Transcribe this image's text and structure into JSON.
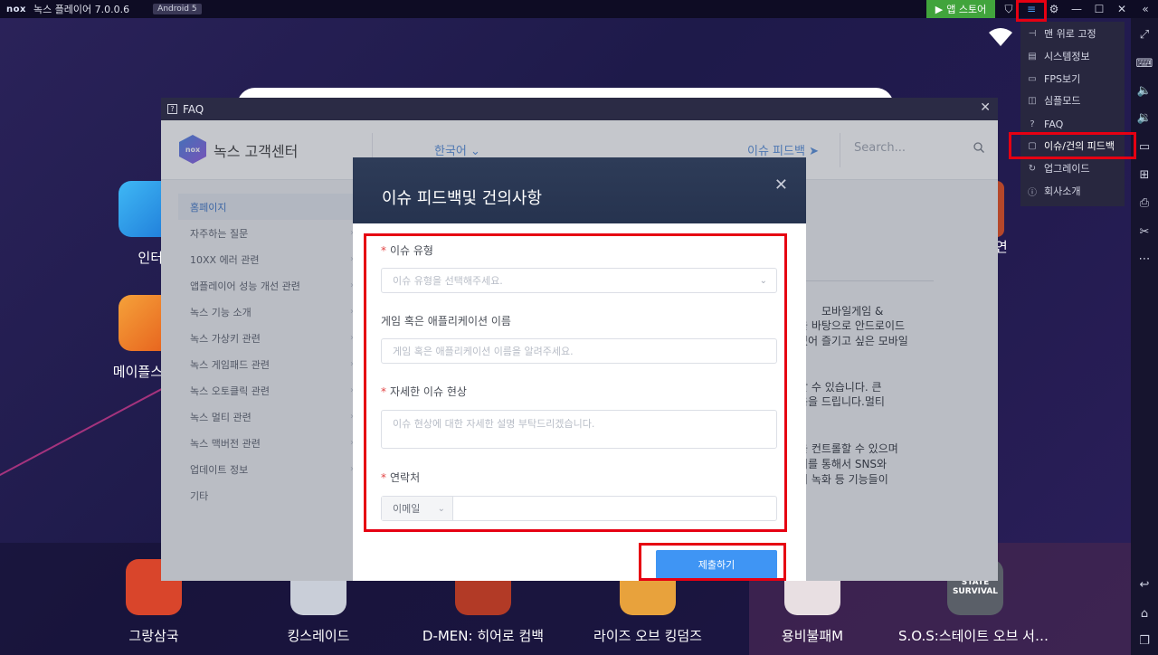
{
  "titlebar": {
    "logo": "nox",
    "title": "녹스 플레이어 7.0.0.6",
    "android_badge": "Android 5",
    "appstore_label": "앱 스토어"
  },
  "dropdown_menu": [
    {
      "icon": "pin-icon",
      "label": "맨 위로 고정"
    },
    {
      "icon": "system-info-icon",
      "label": "시스템정보"
    },
    {
      "icon": "monitor-icon",
      "label": "FPS보기"
    },
    {
      "icon": "simple-mode-icon",
      "label": "심플모드"
    },
    {
      "icon": "question-icon",
      "label": "FAQ"
    },
    {
      "icon": "feedback-icon",
      "label": "이슈/건의 피드백"
    },
    {
      "icon": "refresh-icon",
      "label": "업그레이드"
    },
    {
      "icon": "info-icon",
      "label": "회사소개"
    }
  ],
  "desktop_apps_partial": [
    {
      "label": "인터"
    },
    {
      "label": "메이플스"
    },
    {
      "label": "·:연"
    }
  ],
  "dock_apps": [
    {
      "label": "그랑삼국",
      "color": "#d9452b",
      "badge": "그랑삼국"
    },
    {
      "label": "킹스레이드",
      "color": "#c9ced8",
      "badge": ""
    },
    {
      "label": "D-MEN: 히어로 컴백",
      "color": "#b23a26",
      "badge": ""
    },
    {
      "label": "라이즈 오브 킹덤즈",
      "color": "#e8a23c",
      "badge": ""
    },
    {
      "label": "용비불패M",
      "color": "#e8dfe2",
      "badge": ""
    },
    {
      "label": "S.O.S:스테이트 오브 서바..",
      "color": "#5a5f68",
      "badge": "STATE SURVIVAL"
    }
  ],
  "faq": {
    "window_title": "FAQ",
    "brand": "녹스 고객센터",
    "language": "한국어",
    "issue_feedback_link": "이슈 피드백",
    "search_placeholder": "Search...",
    "sidebar": [
      "홈페이지",
      "자주하는 질문",
      "10XX 에러 관련",
      "앱플레이어 성능 개선 관련",
      "녹스 기능 소개",
      "녹스 가상키 관련",
      "녹스 게임패드 관련",
      "녹스 오토클릭 관련",
      "녹스 멀티 관련",
      "녹스 맥버전 관련",
      "업데이트 정보",
      "기타"
    ],
    "body_fragments": [
      "모바일게임 &",
      "을 바탕으로 안드로이드",
      "있어 즐기고 싶은 모바일",
      "할 수 있습니다. 큰",
      "음을 드립니다.멀티",
      "을 컨트롤할 수 있으며",
      "어를 통해서 SNS와",
      "키 녹화 등 기능들이"
    ]
  },
  "modal": {
    "title": "이슈 피드백및 건의사항",
    "issue_type_label": "이슈 유형",
    "issue_type_placeholder": "이슈 유형을 선택해주세요.",
    "app_name_label": "게임 혹은 애플리케이션 이름",
    "app_name_placeholder": "게임 혹은 애플리케이션 이름을 알려주세요.",
    "detail_label": "자세한 이슈 현상",
    "detail_placeholder": "이슈 현상에 대한 자세한 설명 부탁드리겠습니다.",
    "contact_label": "연락처",
    "contact_type": "이메일",
    "contact_value": "",
    "submit_label": "제출하기"
  },
  "colors": {
    "highlight": "#e60012",
    "accent_blue": "#3f95f4",
    "link_blue": "#4a86d8",
    "appstore_green": "#41a43c"
  }
}
